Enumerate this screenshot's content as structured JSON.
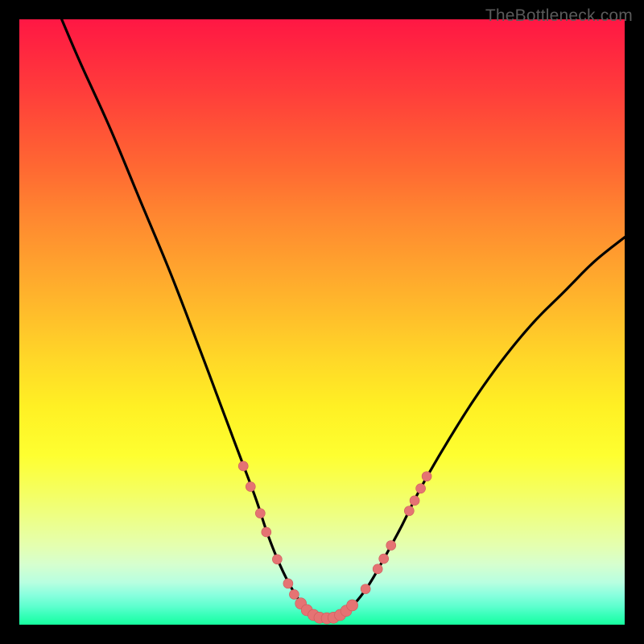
{
  "watermark": "TheBottleneck.com",
  "colors": {
    "border": "#000000",
    "curve_stroke": "#000000",
    "marker_fill": "#e57373",
    "marker_stroke": "#cc5b5b"
  },
  "chart_data": {
    "type": "line",
    "title": "",
    "xlabel": "",
    "ylabel": "",
    "x_range": [
      0,
      100
    ],
    "y_range": [
      0,
      100
    ],
    "series": [
      {
        "name": "bottleneck-curve",
        "x": [
          7,
          10,
          15,
          20,
          25,
          30,
          33,
          36,
          39,
          41,
          43,
          45,
          47,
          48.8,
          50,
          52,
          54,
          56,
          58,
          60,
          63,
          66,
          70,
          75,
          80,
          85,
          90,
          95,
          100
        ],
        "y": [
          100,
          93,
          82,
          70,
          58,
          45,
          37,
          29,
          21,
          15,
          10,
          6,
          3,
          1.5,
          1,
          1.2,
          2.2,
          4.2,
          7,
          10.5,
          16,
          22,
          29,
          37,
          44,
          50,
          55,
          60,
          64
        ]
      }
    ],
    "markers": [
      {
        "x": 37.0,
        "y": 26.2,
        "r": 6
      },
      {
        "x": 38.2,
        "y": 22.8,
        "r": 6
      },
      {
        "x": 39.8,
        "y": 18.4,
        "r": 6
      },
      {
        "x": 40.8,
        "y": 15.3,
        "r": 6
      },
      {
        "x": 42.6,
        "y": 10.8,
        "r": 6
      },
      {
        "x": 44.4,
        "y": 6.8,
        "r": 6
      },
      {
        "x": 45.4,
        "y": 5.0,
        "r": 6
      },
      {
        "x": 46.5,
        "y": 3.5,
        "r": 7
      },
      {
        "x": 47.5,
        "y": 2.4,
        "r": 7
      },
      {
        "x": 48.6,
        "y": 1.6,
        "r": 7
      },
      {
        "x": 49.6,
        "y": 1.15,
        "r": 7
      },
      {
        "x": 50.8,
        "y": 1.05,
        "r": 7
      },
      {
        "x": 51.9,
        "y": 1.15,
        "r": 7
      },
      {
        "x": 53.0,
        "y": 1.6,
        "r": 7
      },
      {
        "x": 54.0,
        "y": 2.3,
        "r": 7
      },
      {
        "x": 55.0,
        "y": 3.2,
        "r": 7
      },
      {
        "x": 57.2,
        "y": 5.9,
        "r": 6
      },
      {
        "x": 59.2,
        "y": 9.2,
        "r": 6
      },
      {
        "x": 60.2,
        "y": 10.9,
        "r": 6
      },
      {
        "x": 61.4,
        "y": 13.1,
        "r": 6
      },
      {
        "x": 64.4,
        "y": 18.8,
        "r": 6
      },
      {
        "x": 65.3,
        "y": 20.5,
        "r": 6
      },
      {
        "x": 66.3,
        "y": 22.5,
        "r": 6
      },
      {
        "x": 67.3,
        "y": 24.5,
        "r": 6
      }
    ]
  }
}
